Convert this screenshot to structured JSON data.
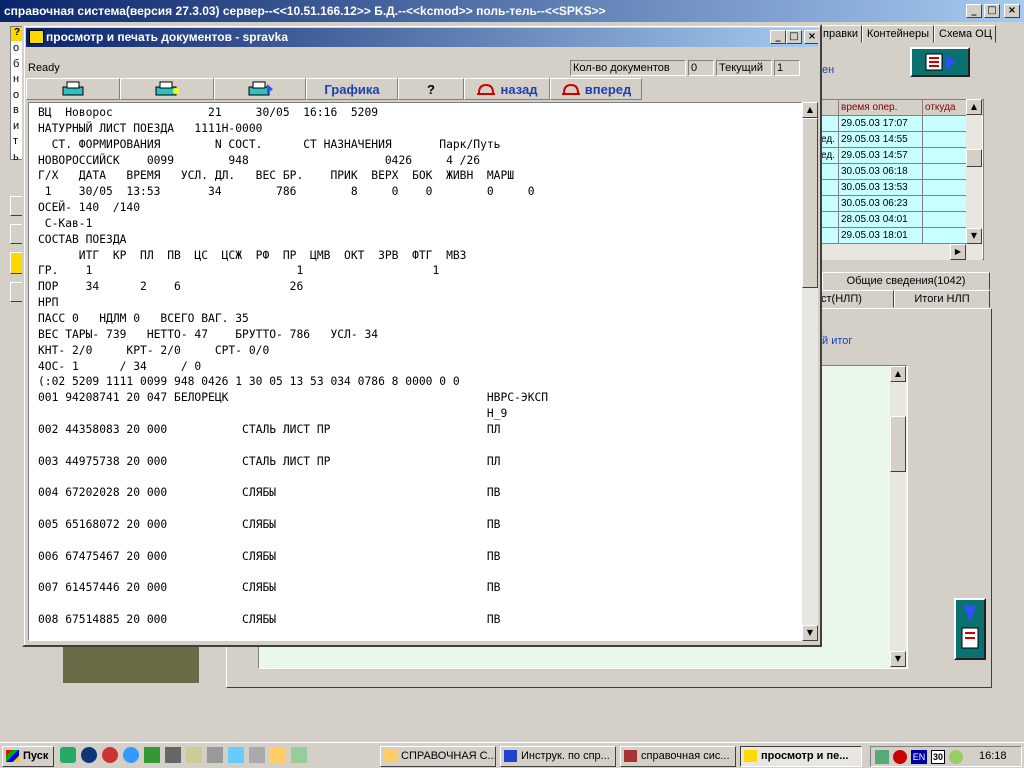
{
  "main_window": {
    "title": "справочная система(версия 27.3.03) сервер--<<10.51.166.12>> Б.Д.--<<kcmod>> поль-тель--<<SPKS>>",
    "tabs": [
      "правки",
      "Контейнеры",
      "Схема ОЦ"
    ],
    "link_text": "ен",
    "left_strip_letters": [
      "о",
      "б",
      "н",
      "о",
      "в",
      "и",
      "т",
      "ь"
    ],
    "grid": {
      "headers": [
        "время опер.",
        "откуда"
      ],
      "rows": [
        {
          "prefix": "",
          "time": "29.05.03 17:07"
        },
        {
          "prefix": "ед.",
          "time": "29.05.03 14:55"
        },
        {
          "prefix": "ед.",
          "time": "29.05.03 14:57"
        },
        {
          "prefix": "",
          "time": "30.05.03 06:18"
        },
        {
          "prefix": "",
          "time": "30.05.03 13:53"
        },
        {
          "prefix": "",
          "time": "30.05.03 06:23"
        },
        {
          "prefix": "",
          "time": "28.05.03 04:01"
        },
        {
          "prefix": "",
          "time": "29.05.03 18:01"
        }
      ]
    },
    "tabs2": {
      "general": "Общие сведения(1042)",
      "nlp": "ст(НЛП)",
      "itogi": "Итоги НЛП"
    },
    "itog_link": "й итог"
  },
  "doc_window": {
    "title": "просмотр и печать документов - spravka",
    "status": "Ready",
    "doc_count_label": "Кол-во документов",
    "doc_count_value": "0",
    "current_label": "Текущий",
    "current_value": "1",
    "toolbar": {
      "graphics": "Графика",
      "help": "?",
      "back": "назад",
      "forward": "вперед"
    },
    "text_lines": [
      "ВЦ  Новорос              21     30/05  16:16  5209",
      "НАТУРНЫЙ ЛИСТ ПОЕЗДА   1111Н-0000",
      "  СТ. ФОРМИРОВАНИЯ        N СОСТ.      СТ НАЗНАЧЕНИЯ       Парк/Путь",
      "НОВОРОССИЙСК    0099        948                    0426     4 /26",
      "Г/Х   ДАТА   ВРЕМЯ   УСЛ. ДЛ.   ВЕС БР.    ПРИК  ВЕРХ  БОК  ЖИВН  МАРШ",
      " 1    30/05  13:53       34        786        8     0    0        0     0",
      "ОСЕЙ- 140  /140",
      " С-Кав-1",
      "СОСТАВ ПОЕЗДА",
      "      ИТГ  КР  ПЛ  ПВ  ЦС  ЦСЖ  РФ  ПР  ЦМВ  ОКТ  ЗРВ  ФТГ  МВЗ",
      "ГР.    1                              1                   1",
      "ПОР    34      2    6                26",
      "НРП",
      "ПАСС 0   НДЛМ 0   ВСЕГО ВАГ. 35",
      "ВЕС ТАРЫ- 739   НЕТТО- 47    БРУТТО- 786   УСЛ- 34",
      "КНТ- 2/0     КРТ- 2/0     СРТ- 0/0",
      "4ОС- 1      / 34     / 0",
      "(:02 5209 1111 0099 948 0426 1 30 05 13 53 034 0786 8 0000 0 0",
      "001 94208741 20 047 БЕЛОРЕЦК                                      НВРС-ЭКСП",
      "                                                                  Н_9",
      "002 44358083 20 000           СТАЛЬ ЛИСТ ПР                       ПЛ",
      "",
      "003 44975738 20 000           СТАЛЬ ЛИСТ ПР                       ПЛ",
      "",
      "004 67202028 20 000           СЛЯБЫ                               ПВ",
      "",
      "005 65168072 20 000           СЛЯБЫ                               ПВ",
      "",
      "006 67475467 20 000           СЛЯБЫ                               ПВ",
      "",
      "007 61457446 20 000           СЛЯБЫ                               ПВ",
      "",
      "008 67514885 20 000           СЛЯБЫ                               ПВ"
    ]
  },
  "taskbar": {
    "start": "Пуск",
    "tasks": [
      "СПРАВОЧНАЯ С...",
      "Инструк. по спр...",
      "справочная сис...",
      "просмотр и пе..."
    ],
    "tray_lang": "EN",
    "tray_date": "30",
    "clock": "16:18"
  },
  "colors": {
    "title_active": "#0a246a",
    "link_blue": "#1f3fb0",
    "grid_cell": "#c8ffff",
    "panel_green": "#eaf8ea",
    "dark_teal": "#0a7070"
  }
}
